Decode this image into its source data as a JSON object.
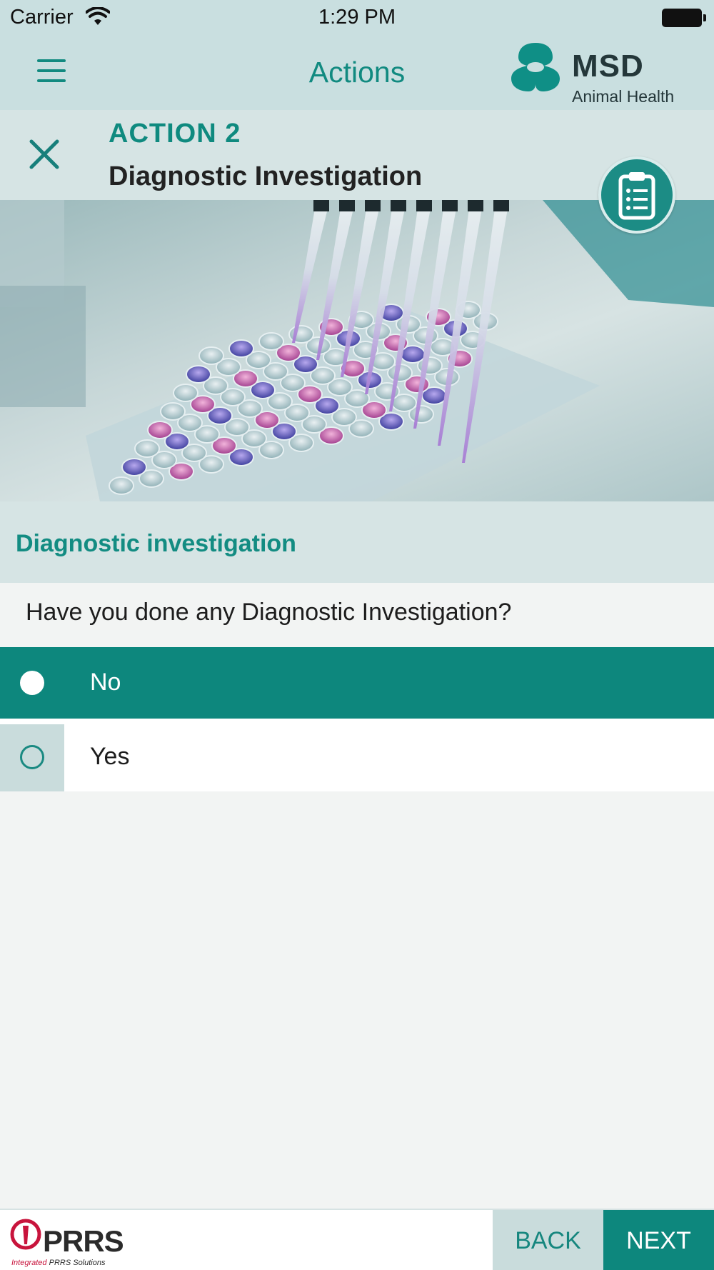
{
  "status_bar": {
    "carrier": "Carrier",
    "time": "1:29 PM"
  },
  "nav": {
    "title": "Actions",
    "menu_icon": "hamburger-menu-icon",
    "logo": {
      "brand": "MSD",
      "subtitle": "Animal Health"
    }
  },
  "action": {
    "label": "ACTION 2",
    "title": "Diagnostic Investigation",
    "close_icon": "close-icon",
    "clipboard_icon": "clipboard-icon"
  },
  "section": {
    "title": "Diagnostic investigation",
    "question": "Have you done any Diagnostic Investigation?"
  },
  "options": [
    {
      "label": "No",
      "selected": true
    },
    {
      "label": "Yes",
      "selected": false
    }
  ],
  "footer": {
    "logo_word": "PRRS",
    "logo_tag_red": "Integrated",
    "logo_tag_rest": "PRRS Solutions",
    "back_label": "BACK",
    "next_label": "NEXT"
  },
  "colors": {
    "accent": "#0d877d",
    "header_bg": "#c9dfe0",
    "section_bg": "#d6e4e4",
    "page_bg": "#f2f4f3"
  }
}
